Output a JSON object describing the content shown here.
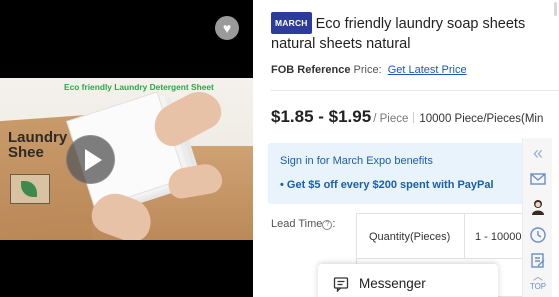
{
  "video": {
    "caption": "Eco friendly Laundry Detergent Sheet",
    "box_label": "Laundry D\nShee",
    "play_icon": "play-icon",
    "favorite_icon": "heart-icon"
  },
  "product": {
    "brand_badge": "MARCH",
    "title": "Eco friendly laundry soap sheets natural sheets natural",
    "fob_label": "FOB Reference",
    "fob_suffix": " Price:",
    "fob_link": "Get Latest Price",
    "price_range": "$1.85 - $1.95",
    "price_unit": "/ Piece",
    "moq": "10000 Piece/Pieces(Min"
  },
  "expo": {
    "signin_text": "Sign in for March Expo benefits",
    "offer_text": "• Get $5 off every $200 spent with PayPal"
  },
  "lead_time": {
    "label": "Lead Time",
    "help_icon": "?",
    "quantity_header": "Quantity(Pieces)",
    "quantity_value": "1 - 10000"
  },
  "rail": {
    "collapse_icon": "«",
    "mail_icon": "mail-icon",
    "person_icon": "person-icon",
    "clock_icon": "clock-icon",
    "note_icon": "note-icon",
    "top_label": "TOP"
  },
  "messenger": {
    "label": "Messenger",
    "icon": "chat-icon"
  },
  "colors": {
    "badge": "#2c3b9c",
    "link": "#1a56c6",
    "expo_bg": "#e8f3fb",
    "expo_text": "#1a5fa9",
    "caption_green": "#2aa84a"
  }
}
